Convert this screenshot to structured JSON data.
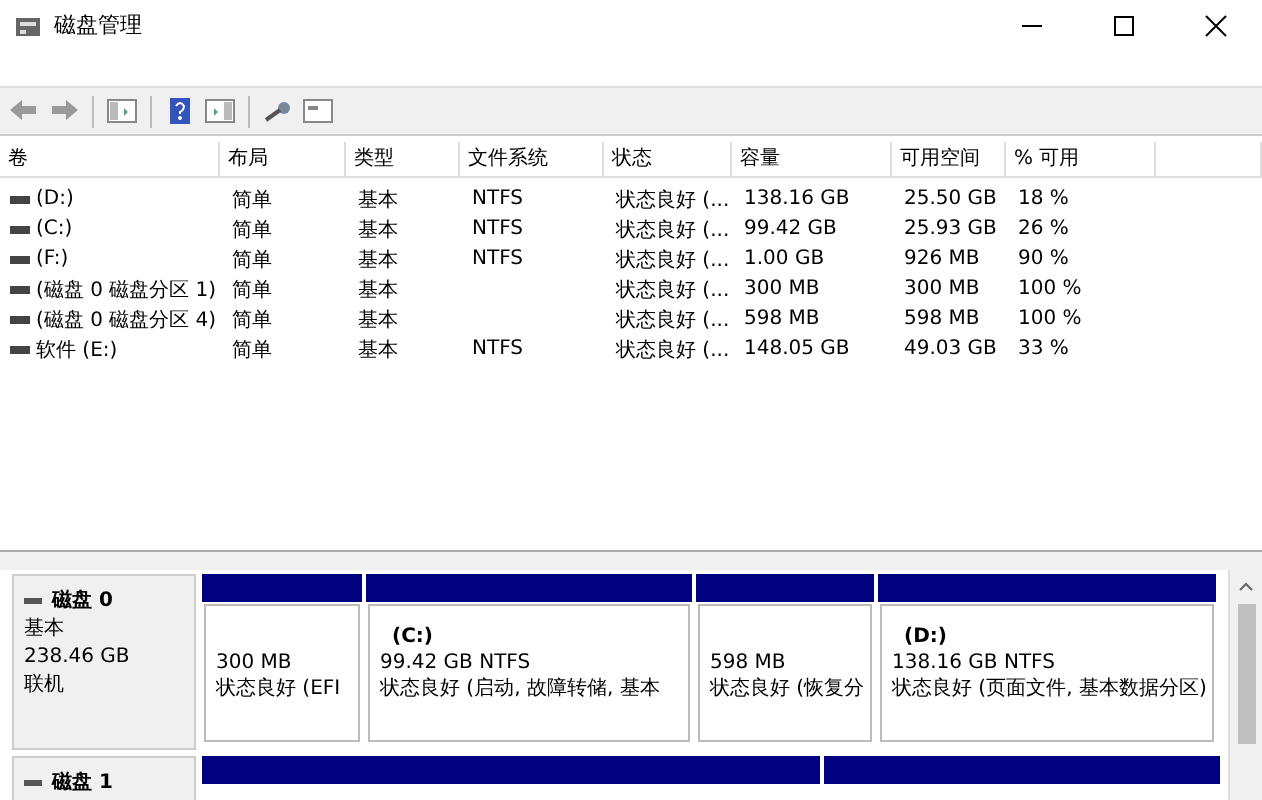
{
  "window": {
    "title": "磁盘管理"
  },
  "columns": [
    "卷",
    "布局",
    "类型",
    "文件系统",
    "状态",
    "容量",
    "可用空间",
    "% 可用"
  ],
  "volumes": [
    {
      "cells": [
        "(D:)",
        "简单",
        "基本",
        "NTFS",
        "状态良好 (...",
        "138.16 GB",
        "25.50 GB",
        "18 %"
      ]
    },
    {
      "cells": [
        "(C:)",
        "简单",
        "基本",
        "NTFS",
        "状态良好 (...",
        "99.42 GB",
        "25.93 GB",
        "26 %"
      ]
    },
    {
      "cells": [
        "(F:)",
        "简单",
        "基本",
        "NTFS",
        "状态良好 (...",
        "1.00 GB",
        "926 MB",
        "90 %"
      ]
    },
    {
      "cells": [
        "(磁盘 0 磁盘分区 1)",
        "简单",
        "基本",
        "",
        "状态良好 (...",
        "300 MB",
        "300 MB",
        "100 %"
      ]
    },
    {
      "cells": [
        "(磁盘 0 磁盘分区 4)",
        "简单",
        "基本",
        "",
        "状态良好 (...",
        "598 MB",
        "598 MB",
        "100 %"
      ]
    },
    {
      "cells": [
        "软件 (E:)",
        "简单",
        "基本",
        "NTFS",
        "状态良好 (...",
        "148.05 GB",
        "49.03 GB",
        "33 %"
      ]
    }
  ],
  "disks": [
    {
      "name": "磁盘 0",
      "type": "基本",
      "size": "238.46 GB",
      "status": "联机",
      "partitions": [
        {
          "kind": "primary",
          "size": "300 MB",
          "status": "状态良好 (EFI"
        },
        {
          "kind": "primary",
          "label": "(C:)",
          "size": "99.42 GB NTFS",
          "status": "状态良好 (启动, 故障转储, 基本"
        },
        {
          "kind": "primary",
          "size": "598 MB",
          "status": "状态良好 (恢复分"
        },
        {
          "kind": "primary",
          "label": "(D:)",
          "size": "138.16 GB NTFS",
          "status": "状态良好 (页面文件, 基本数据分区)"
        }
      ]
    },
    {
      "name": "磁盘 1",
      "partitions": [
        {
          "kind": "primary"
        },
        {
          "kind": "primary"
        }
      ]
    }
  ]
}
